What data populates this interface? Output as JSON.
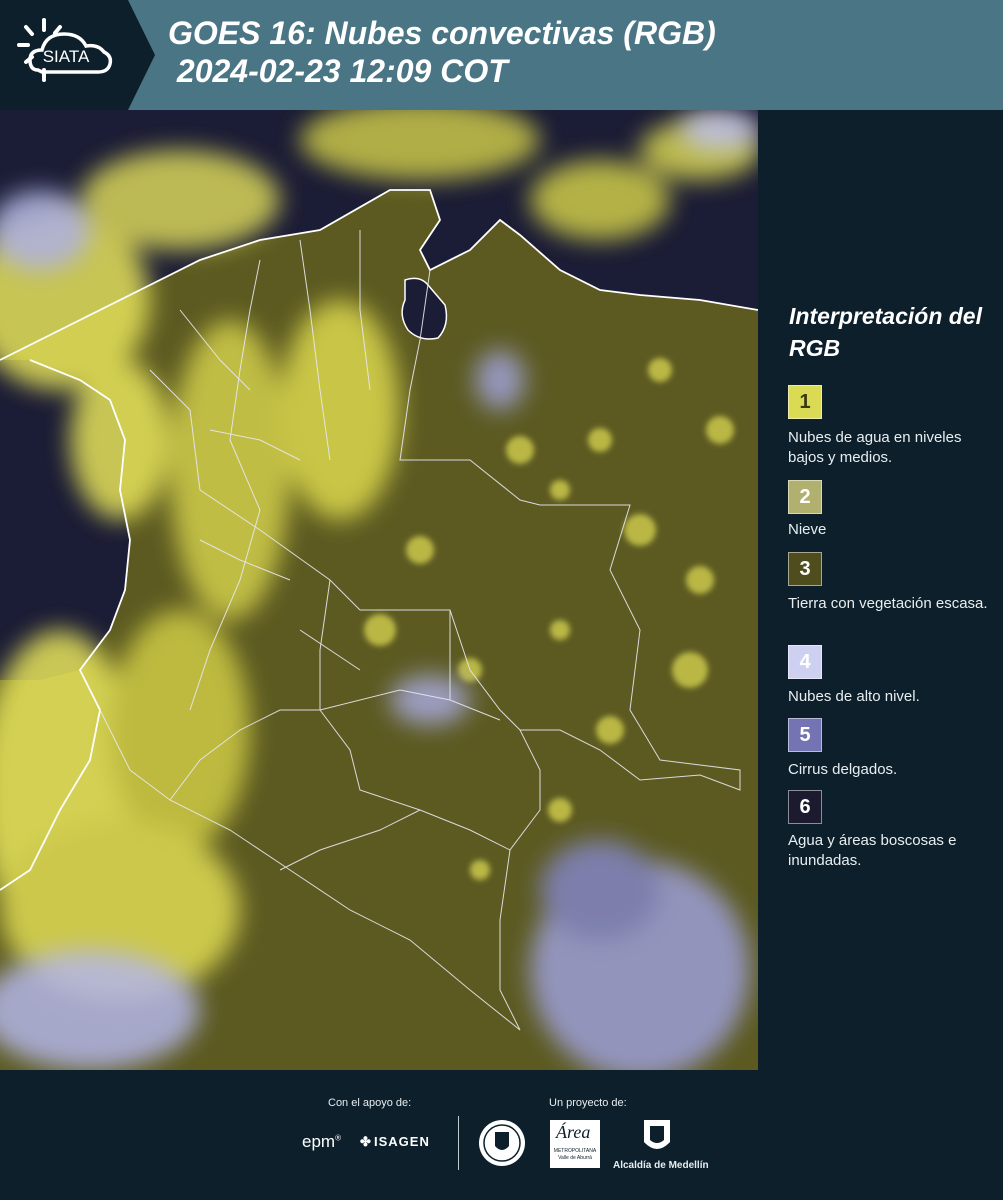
{
  "header": {
    "logo_text": "SIATA",
    "title": "GOES 16: Nubes convectivas (RGB)\n 2024-02-23 12:09 COT",
    "bg_color": "#4a7585"
  },
  "map": {
    "region": "Colombia",
    "land_color": "#5f5d22",
    "cloud_color": "#e6e35a",
    "water_color": "#1c1d36",
    "high_cloud_color": "#b9b9e8"
  },
  "legend": {
    "title": "Interpretación del RGB",
    "items": [
      {
        "number": "1",
        "label": "Nubes de agua en niveles bajos y medios.",
        "color": "#dada55"
      },
      {
        "number": "2",
        "label": "Nieve",
        "color": "#b2b06e"
      },
      {
        "number": "3",
        "label": "Tierra con vegetación escasa.",
        "color": "#4f4d1e"
      },
      {
        "number": "4",
        "label": "Nubes de alto nivel.",
        "color": "#cdd0f0"
      },
      {
        "number": "5",
        "label": "Cirrus delgados.",
        "color": "#7474b4"
      },
      {
        "number": "6",
        "label": "Agua y áreas boscosas e inundadas.",
        "color": "#1b1a2e"
      }
    ]
  },
  "footer": {
    "support_label": "Con el apoyo de:",
    "project_label": "Un proyecto de:",
    "sponsor_epm": "epm",
    "sponsor_isagen": "ISAGEN",
    "partner_area": "METROPOLITANA Valle de Aburrá",
    "partner_alcaldia": "Alcaldía de Medellín"
  }
}
